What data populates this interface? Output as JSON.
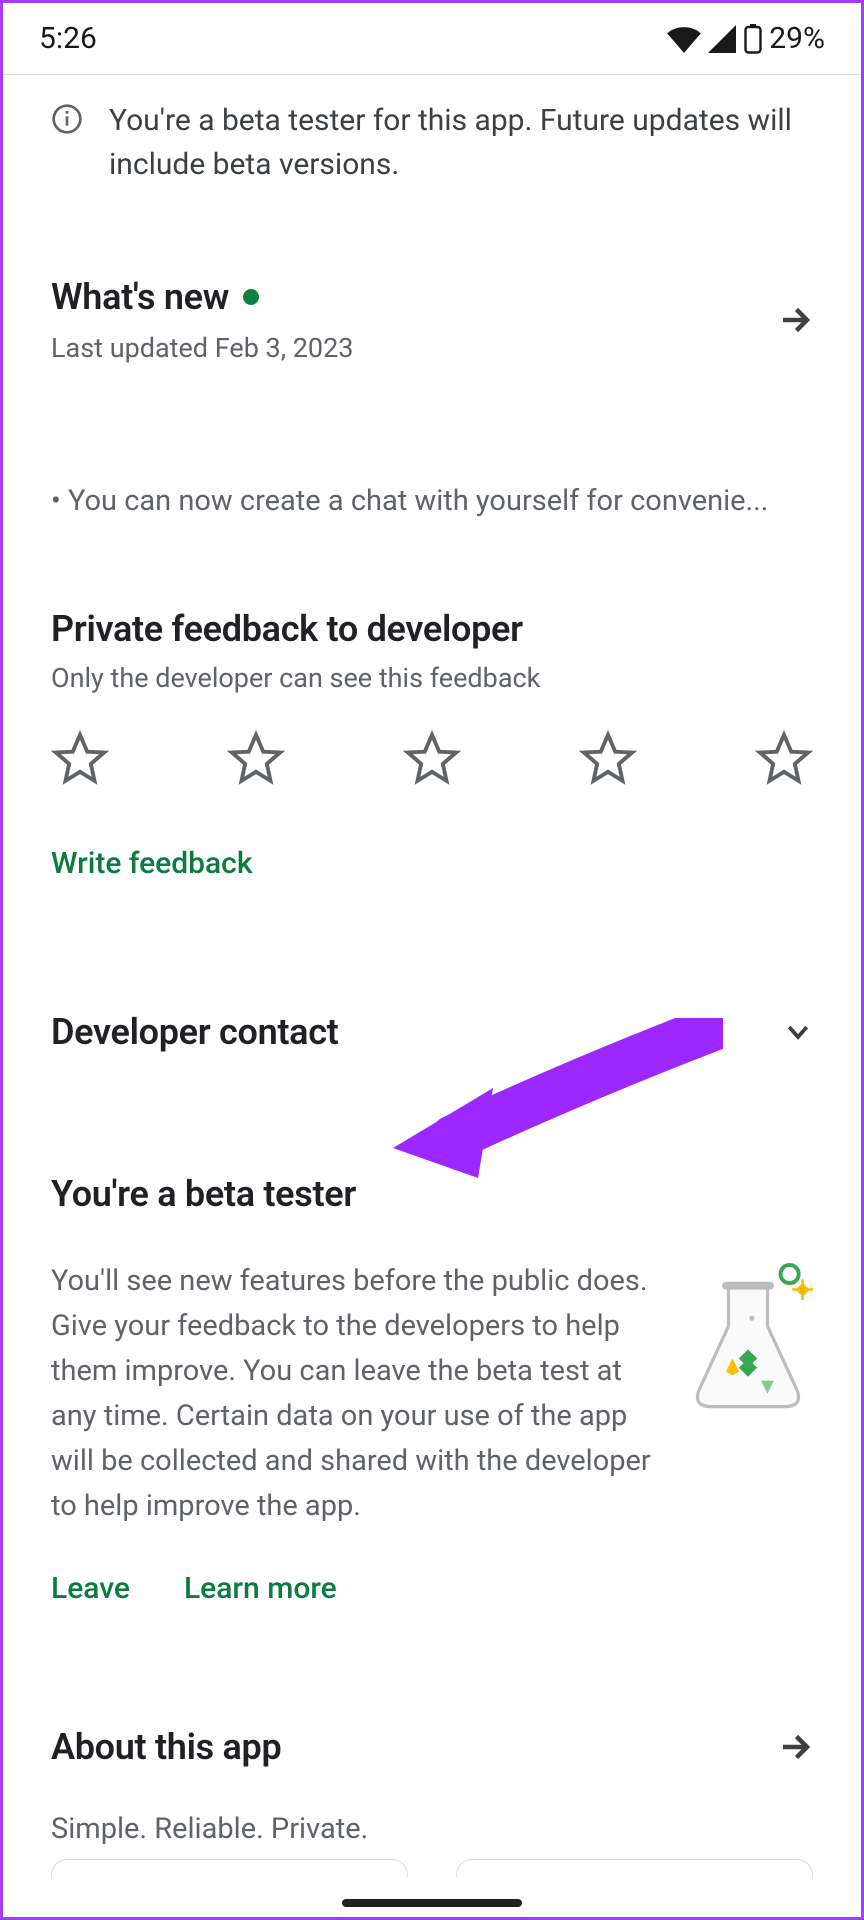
{
  "status": {
    "time": "5:26",
    "battery": "29%"
  },
  "banner": {
    "text": "You're a beta tester for this app. Future updates will include beta versions."
  },
  "whats_new": {
    "title": "What's new",
    "updated": "Last updated Feb 3, 2023",
    "changelog": "• You can now create a chat with yourself for convenie..."
  },
  "feedback": {
    "title": "Private feedback to developer",
    "subtitle": "Only the developer can see this feedback",
    "write": "Write feedback"
  },
  "developer_contact": {
    "title": "Developer contact"
  },
  "beta": {
    "title": "You're a beta tester",
    "body": "You'll see new features before the public does. Give your feedback to the developers to help them improve. You can leave the beta test at any time. Certain data on your use of the app will be collected and shared with the developer to help improve the app.",
    "leave": "Leave",
    "learn_more": "Learn more"
  },
  "about": {
    "title": "About this app",
    "subtitle": "Simple. Reliable. Private."
  }
}
